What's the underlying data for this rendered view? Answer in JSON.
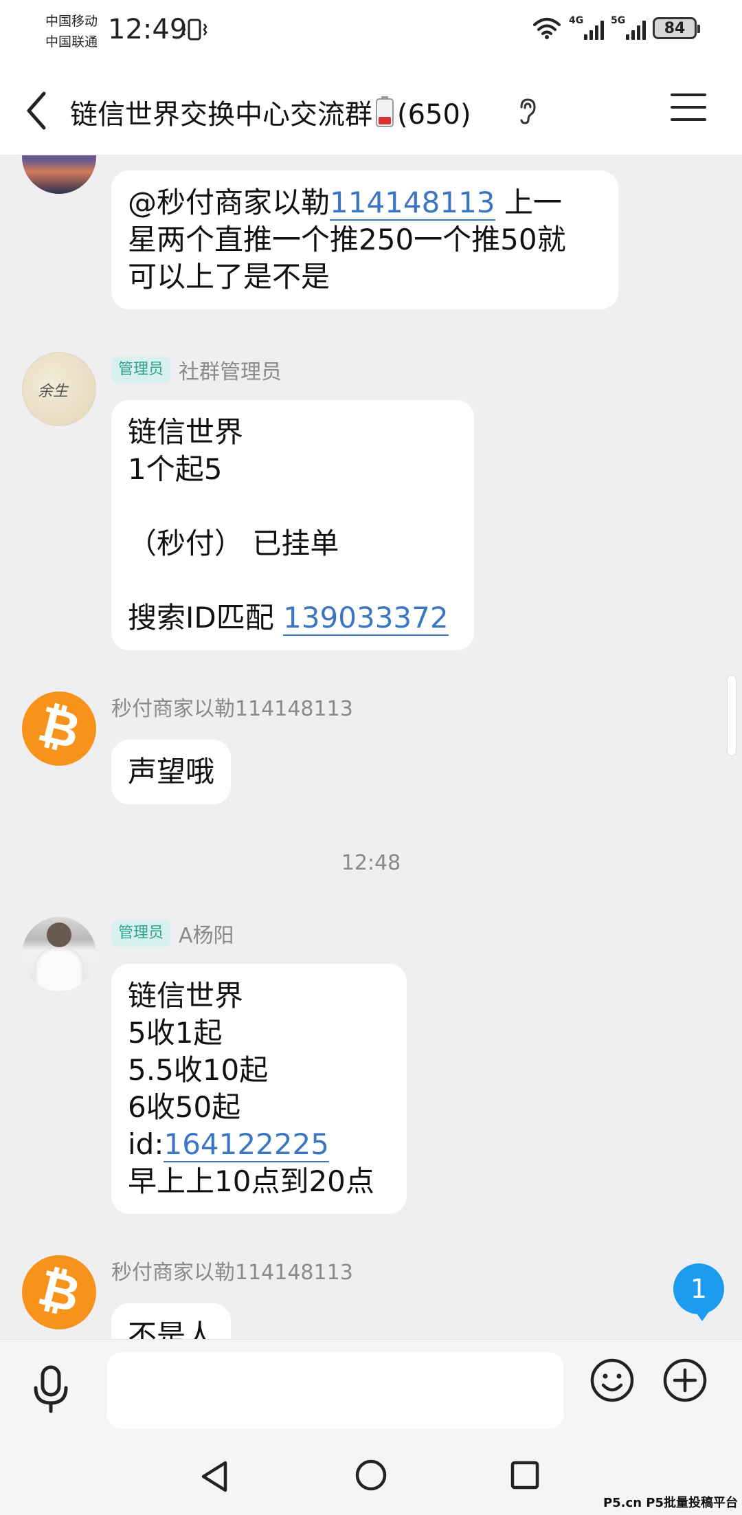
{
  "status_bar": {
    "carrier1": "中国移动",
    "carrier2": "中国联通",
    "time": "12:49",
    "net1": "4G",
    "net2": "5G",
    "battery": "84"
  },
  "header": {
    "title": "链信世界交换中心交流群",
    "member_count": "(650)"
  },
  "messages": [
    {
      "type": "message",
      "text_prefix": "@秒付商家以勒",
      "link": "114148113",
      "text_suffix": " 上一\n星两个直推一个推250一个推50就\n可以上了是不是"
    },
    {
      "type": "message",
      "badge": "管理员",
      "sender": "社群管理员",
      "text": "链信世界\n1个起5\n\n（秒付） 已挂单\n\n搜索ID匹配 ",
      "link": "139033372"
    },
    {
      "type": "message",
      "sender": "秒付商家以勒114148113",
      "text": "声望哦"
    },
    {
      "type": "time",
      "text": "12:48"
    },
    {
      "type": "message",
      "badge": "管理员",
      "sender": "A杨阳",
      "text": "链信世界\n5收1起\n5.5收10起\n6收50起\nid:",
      "link": "164122225",
      "text_suffix": "\n早上上10点到20点"
    },
    {
      "type": "message",
      "sender": "秒付商家以勒114148113",
      "text": "不是人"
    }
  ],
  "avatar_text": "余生",
  "unread_count": "1",
  "input": {
    "placeholder": ""
  },
  "watermark": "P5.cn P5批量投稿平台",
  "colors": {
    "link": "#3b76c4",
    "badge_bg": "#d8f1ec",
    "badge_text": "#2ea38f",
    "unread": "#1d9bf0",
    "bitcoin": "#f7931a"
  }
}
